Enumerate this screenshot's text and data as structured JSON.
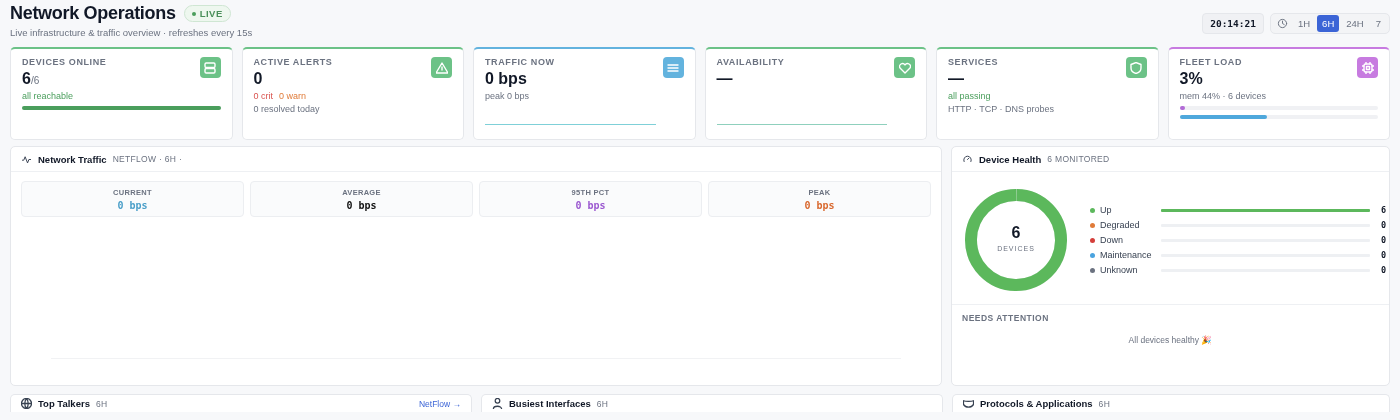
{
  "header": {
    "title": "Network Operations",
    "live_badge": "LIVE",
    "subtitle": "Live infrastructure & traffic overview · refreshes every 15s",
    "clock": "20:14:21",
    "ranges": [
      {
        "label": "1H",
        "selected": false
      },
      {
        "label": "6H",
        "selected": true
      },
      {
        "label": "24H",
        "selected": false
      },
      {
        "label": "7",
        "selected": false
      }
    ]
  },
  "kpis": [
    {
      "label": "DEVICES ONLINE",
      "value": "6",
      "suffix": "/6",
      "color": "#6cc287",
      "details": [
        {
          "kind": "text",
          "parts": [
            {
              "text": "all reachable",
              "kind": "ok"
            }
          ]
        },
        {
          "kind": "bar",
          "level": 1,
          "color": "#4a9e5c"
        }
      ]
    },
    {
      "label": "ACTIVE ALERTS",
      "value": "0",
      "color": "#6cc287",
      "details": [
        {
          "kind": "text",
          "parts": [
            {
              "text": "0 crit",
              "kind": "crit"
            },
            {
              "text": "0 warn",
              "kind": "warn"
            }
          ]
        },
        {
          "kind": "text",
          "parts": [
            {
              "text": "0 resolved today",
              "kind": "muted"
            }
          ]
        }
      ]
    },
    {
      "label": "TRAFFIC NOW",
      "value": "0 bps",
      "color": "#63b3de",
      "details": [
        {
          "kind": "text",
          "parts": [
            {
              "text": "peak 0 bps",
              "kind": "muted"
            }
          ]
        },
        {
          "kind": "sparkline",
          "color": "#7fd0d8"
        }
      ]
    },
    {
      "label": "AVAILABILITY",
      "value": "—",
      "color": "#6cc287",
      "details": [
        {
          "kind": "sparkline",
          "color": "#8fd0bd"
        }
      ]
    },
    {
      "label": "SERVICES",
      "value": "—",
      "color": "#6cc287",
      "details": [
        {
          "kind": "text",
          "parts": [
            {
              "text": "all passing",
              "kind": "ok"
            }
          ]
        },
        {
          "kind": "text",
          "parts": [
            {
              "text": "HTTP · TCP · DNS probes",
              "kind": "muted"
            }
          ]
        }
      ]
    },
    {
      "label": "FLEET LOAD",
      "value": "3%",
      "color": "#c77be0",
      "details": [
        {
          "kind": "text",
          "parts": [
            {
              "text": "mem 44% · 6 devices",
              "kind": "muted"
            }
          ]
        },
        {
          "kind": "bar",
          "level": 0.03,
          "color": "#b26bd6"
        },
        {
          "kind": "bar",
          "level": 0.44,
          "color": "#4fa8dc"
        }
      ]
    }
  ],
  "traffic": {
    "title": "Network Traffic",
    "meta": "NETFLOW · 6H ·",
    "stats": [
      {
        "label": "CURRENT",
        "value": "0 bps",
        "color": "#4b9fc9"
      },
      {
        "label": "AVERAGE",
        "value": "0 bps",
        "color": "#111111"
      },
      {
        "label": "95TH PCT",
        "value": "0 bps",
        "color": "#9b59d0"
      },
      {
        "label": "PEAK",
        "value": "0 bps",
        "color": "#d9692f"
      }
    ]
  },
  "health": {
    "title": "Device Health",
    "meta": "6 MONITORED",
    "total": "6",
    "total_label": "DEVICES",
    "statuses": [
      {
        "label": "Up",
        "color": "#5cb85c",
        "level": 1,
        "count": "6"
      },
      {
        "label": "Degraded",
        "color": "#e07b39",
        "level": 0,
        "count": "0"
      },
      {
        "label": "Down",
        "color": "#d43f3a",
        "level": 0,
        "count": "0"
      },
      {
        "label": "Maintenance",
        "color": "#4aa3df",
        "level": 0,
        "count": "0"
      },
      {
        "label": "Unknown",
        "color": "#6b7280",
        "level": 0,
        "count": "0"
      }
    ],
    "attention_title": "NEEDS ATTENTION",
    "attention_text": "All devices healthy 🎉"
  },
  "panels": [
    {
      "title": "Top Talkers",
      "meta": "6H",
      "link": "NetFlow →"
    },
    {
      "title": "Busiest Interfaces",
      "meta": "6H"
    },
    {
      "title": "Protocols & Applications",
      "meta": "6H"
    }
  ]
}
